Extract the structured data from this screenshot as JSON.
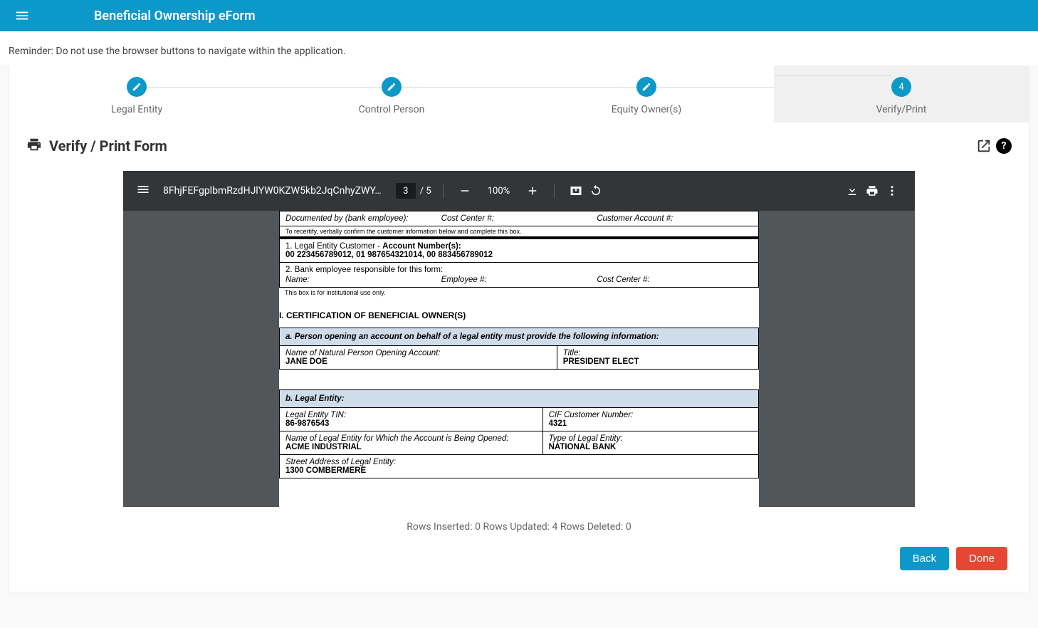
{
  "header": {
    "title": "Beneficial Ownership eForm"
  },
  "reminder": "Reminder: Do not use the browser buttons to navigate within the application.",
  "stepper": {
    "steps": [
      {
        "label": "Legal Entity"
      },
      {
        "label": "Control Person"
      },
      {
        "label": "Equity Owner(s)"
      },
      {
        "label": "Verify/Print",
        "badge": "4"
      }
    ]
  },
  "section": {
    "title": "Verify / Print Form"
  },
  "pdf": {
    "filename": "8FhjFEFgplbmRzdHJlYW0KZW5kb2JqCnhyZWY…",
    "page_current": "3",
    "page_total": "5",
    "zoom": "100%",
    "doc": {
      "documented_by_label": "Documented by (bank employee):",
      "cost_center_label": "Cost Center #:",
      "customer_account_label": "Customer Account #:",
      "recertify_text": "To recertify, verbally confirm the customer information below and complete this box.",
      "line1_prefix": "1. Legal Entity Customer -",
      "line1_label": "Account Number(s):",
      "account_numbers": "00 223456789012, 01 987654321014, 00 883456789012",
      "line2_label": "2. Bank employee responsible for this form:",
      "name_label": "Name:",
      "employee_no_label": "Employee #:",
      "cost_center_label2": "Cost Center #:",
      "institutional_text": "This box is for institutional use only.",
      "cert_heading": "I.   CERTIFICATION OF BENEFICIAL OWNER(S)",
      "a_head": "a. Person opening an account on behalf of a legal entity must provide the following information:",
      "name_open_label": "Name of Natural Person Opening Account:",
      "name_open_value": "JANE DOE",
      "title_label": "Title:",
      "title_value": "PRESIDENT ELECT",
      "b_head": "b. Legal Entity:",
      "tin_label": "Legal Entity TIN:",
      "tin_value": "86-9876543",
      "cif_label": "CIF Customer Number:",
      "cif_value": "4321",
      "entity_name_label": "Name of Legal Entity for Which the Account is Being Opened:",
      "entity_name_value": "ACME INDUSTRIAL",
      "entity_type_label": "Type of Legal Entity:",
      "entity_type_value": "NATIONAL BANK",
      "street_label": "Street Address of Legal Entity:",
      "street_value": "1300 COMBERMERE"
    }
  },
  "status": {
    "inserted_label": "Rows Inserted:",
    "inserted": "0",
    "updated_label": "Rows Updated:",
    "updated": "4",
    "deleted_label": "Rows Deleted:",
    "deleted": "0"
  },
  "buttons": {
    "back": "Back",
    "done": "Done"
  }
}
